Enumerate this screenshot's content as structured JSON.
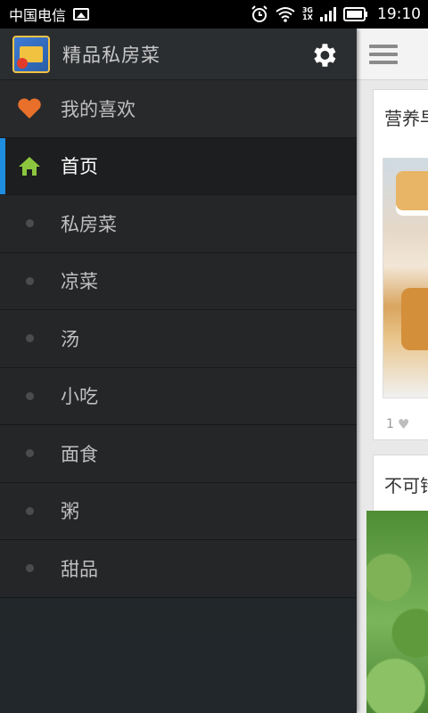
{
  "status_bar": {
    "carrier": "中国电信",
    "network": "3G\n1X",
    "time": "19:10"
  },
  "drawer": {
    "app_title": "精品私房菜",
    "items": [
      {
        "label": "我的喜欢",
        "icon": "heart-icon"
      },
      {
        "label": "首页",
        "icon": "home-icon",
        "active": true
      },
      {
        "label": "私房菜",
        "icon": "dot-icon"
      },
      {
        "label": "凉菜",
        "icon": "dot-icon"
      },
      {
        "label": "汤",
        "icon": "dot-icon"
      },
      {
        "label": "小吃",
        "icon": "dot-icon"
      },
      {
        "label": "面食",
        "icon": "dot-icon"
      },
      {
        "label": "粥",
        "icon": "dot-icon"
      },
      {
        "label": "甜品",
        "icon": "dot-icon"
      }
    ]
  },
  "content": {
    "cards": [
      {
        "title": "营养早",
        "likes": "1"
      },
      {
        "title": "不可错"
      }
    ]
  },
  "colors": {
    "accent": "#1f8de0",
    "heart": "#e8702a",
    "home": "#8cc63f",
    "drawer_bg": "#232527"
  }
}
